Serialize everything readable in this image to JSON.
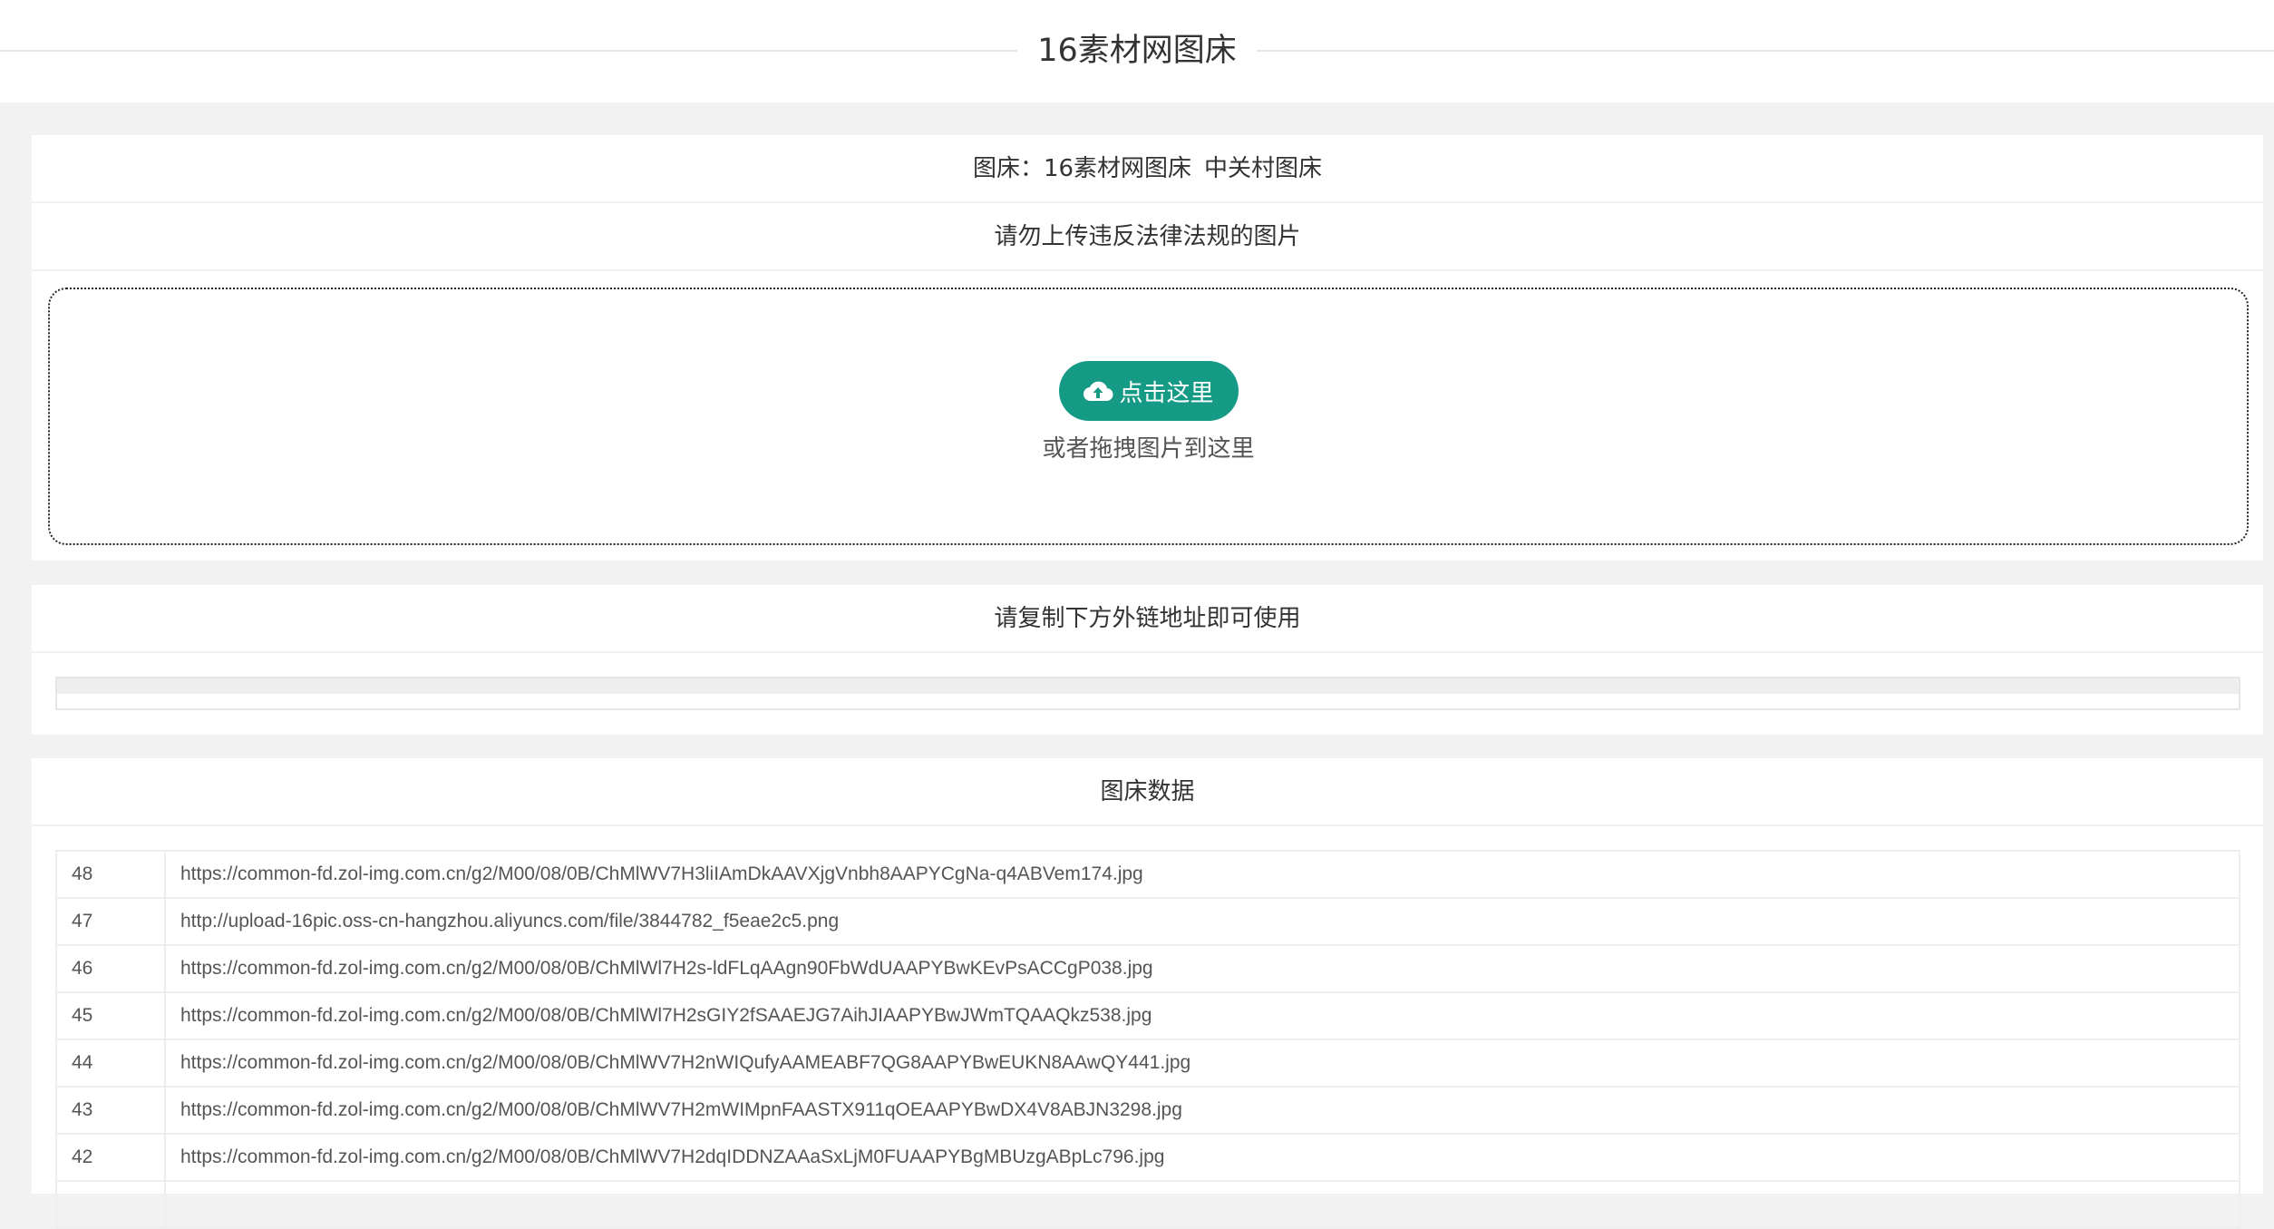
{
  "header": {
    "title": "16素材网图床"
  },
  "upload_card": {
    "bed_prefix": "图床：",
    "beds": [
      "16素材网图床",
      "中关村图床"
    ],
    "notice": "请勿上传违反法律法规的图片",
    "button_label": "点击这里",
    "button_icon": "cloud-upload-icon",
    "drop_hint": "或者拖拽图片到这里",
    "accent_color": "#159a86"
  },
  "link_card": {
    "title": "请复制下方外链地址即可使用",
    "link_value": ""
  },
  "data_card": {
    "title": "图床数据",
    "rows": [
      {
        "id": "48",
        "url": "https://common-fd.zol-img.com.cn/g2/M00/08/0B/ChMlWV7H3liIAmDkAAVXjgVnbh8AAPYCgNa-q4ABVem174.jpg"
      },
      {
        "id": "47",
        "url": "http://upload-16pic.oss-cn-hangzhou.aliyuncs.com/file/3844782_f5eae2c5.png"
      },
      {
        "id": "46",
        "url": "https://common-fd.zol-img.com.cn/g2/M00/08/0B/ChMlWl7H2s-ldFLqAAgn90FbWdUAAPYBwKEvPsACCgP038.jpg"
      },
      {
        "id": "45",
        "url": "https://common-fd.zol-img.com.cn/g2/M00/08/0B/ChMlWl7H2sGIY2fSAAEJG7AihJIAAPYBwJWmTQAAQkz538.jpg"
      },
      {
        "id": "44",
        "url": "https://common-fd.zol-img.com.cn/g2/M00/08/0B/ChMlWV7H2nWIQufyAAMEABF7QG8AAPYBwEUKN8AAwQY441.jpg"
      },
      {
        "id": "43",
        "url": "https://common-fd.zol-img.com.cn/g2/M00/08/0B/ChMlWV7H2mWIMpnFAASTX911qOEAAPYBwDX4V8ABJN3298.jpg"
      },
      {
        "id": "42",
        "url": "https://common-fd.zol-img.com.cn/g2/M00/08/0B/ChMlWV7H2dqIDDNZAAaSxLjM0FUAAPYBgMBUzgABpLc796.jpg"
      },
      {
        "id": "",
        "url": ""
      }
    ]
  }
}
